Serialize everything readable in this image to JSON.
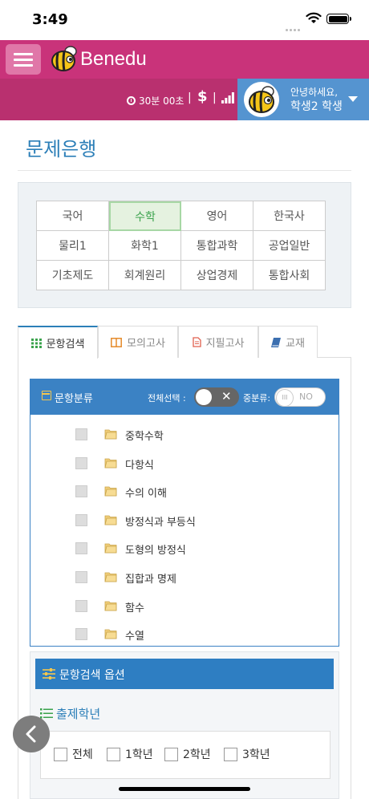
{
  "status_bar": {
    "time": "3:49"
  },
  "header": {
    "brand": "Benedu"
  },
  "info_bar": {
    "timer": "30분 00초",
    "separator": "|",
    "currency": "$",
    "greeting": "안녕하세요,",
    "user_name": "학생2 학생"
  },
  "page": {
    "title": "문제은행"
  },
  "subjects": [
    "국어",
    "수학",
    "영어",
    "한국사",
    "물리1",
    "화학1",
    "통합과학",
    "공업일반",
    "기초제도",
    "회계원리",
    "상업경제",
    "통합사회"
  ],
  "active_subject": "수학",
  "tabs": [
    "문항검색",
    "모의고사",
    "지필고사",
    "교재"
  ],
  "category_panel": {
    "title": "문항분류",
    "select_all_label": "전체선택 :",
    "mid_class_label": "중분류:",
    "toggle_off_text": "NO",
    "toggle_knob_text": "III",
    "items": [
      "중학수학",
      "다항식",
      "수의 이해",
      "방정식과 부등식",
      "도형의 방정식",
      "집합과 명제",
      "함수",
      "수열"
    ]
  },
  "options_panel": {
    "title": "문항검색 옵션",
    "grade_title": "출제학년",
    "grades": [
      "전체",
      "1학년",
      "2학년",
      "3학년"
    ]
  },
  "colors": {
    "brand_pink": "#c9337a",
    "accent_blue": "#2c7fb8",
    "active_green": "#3aa24c"
  }
}
